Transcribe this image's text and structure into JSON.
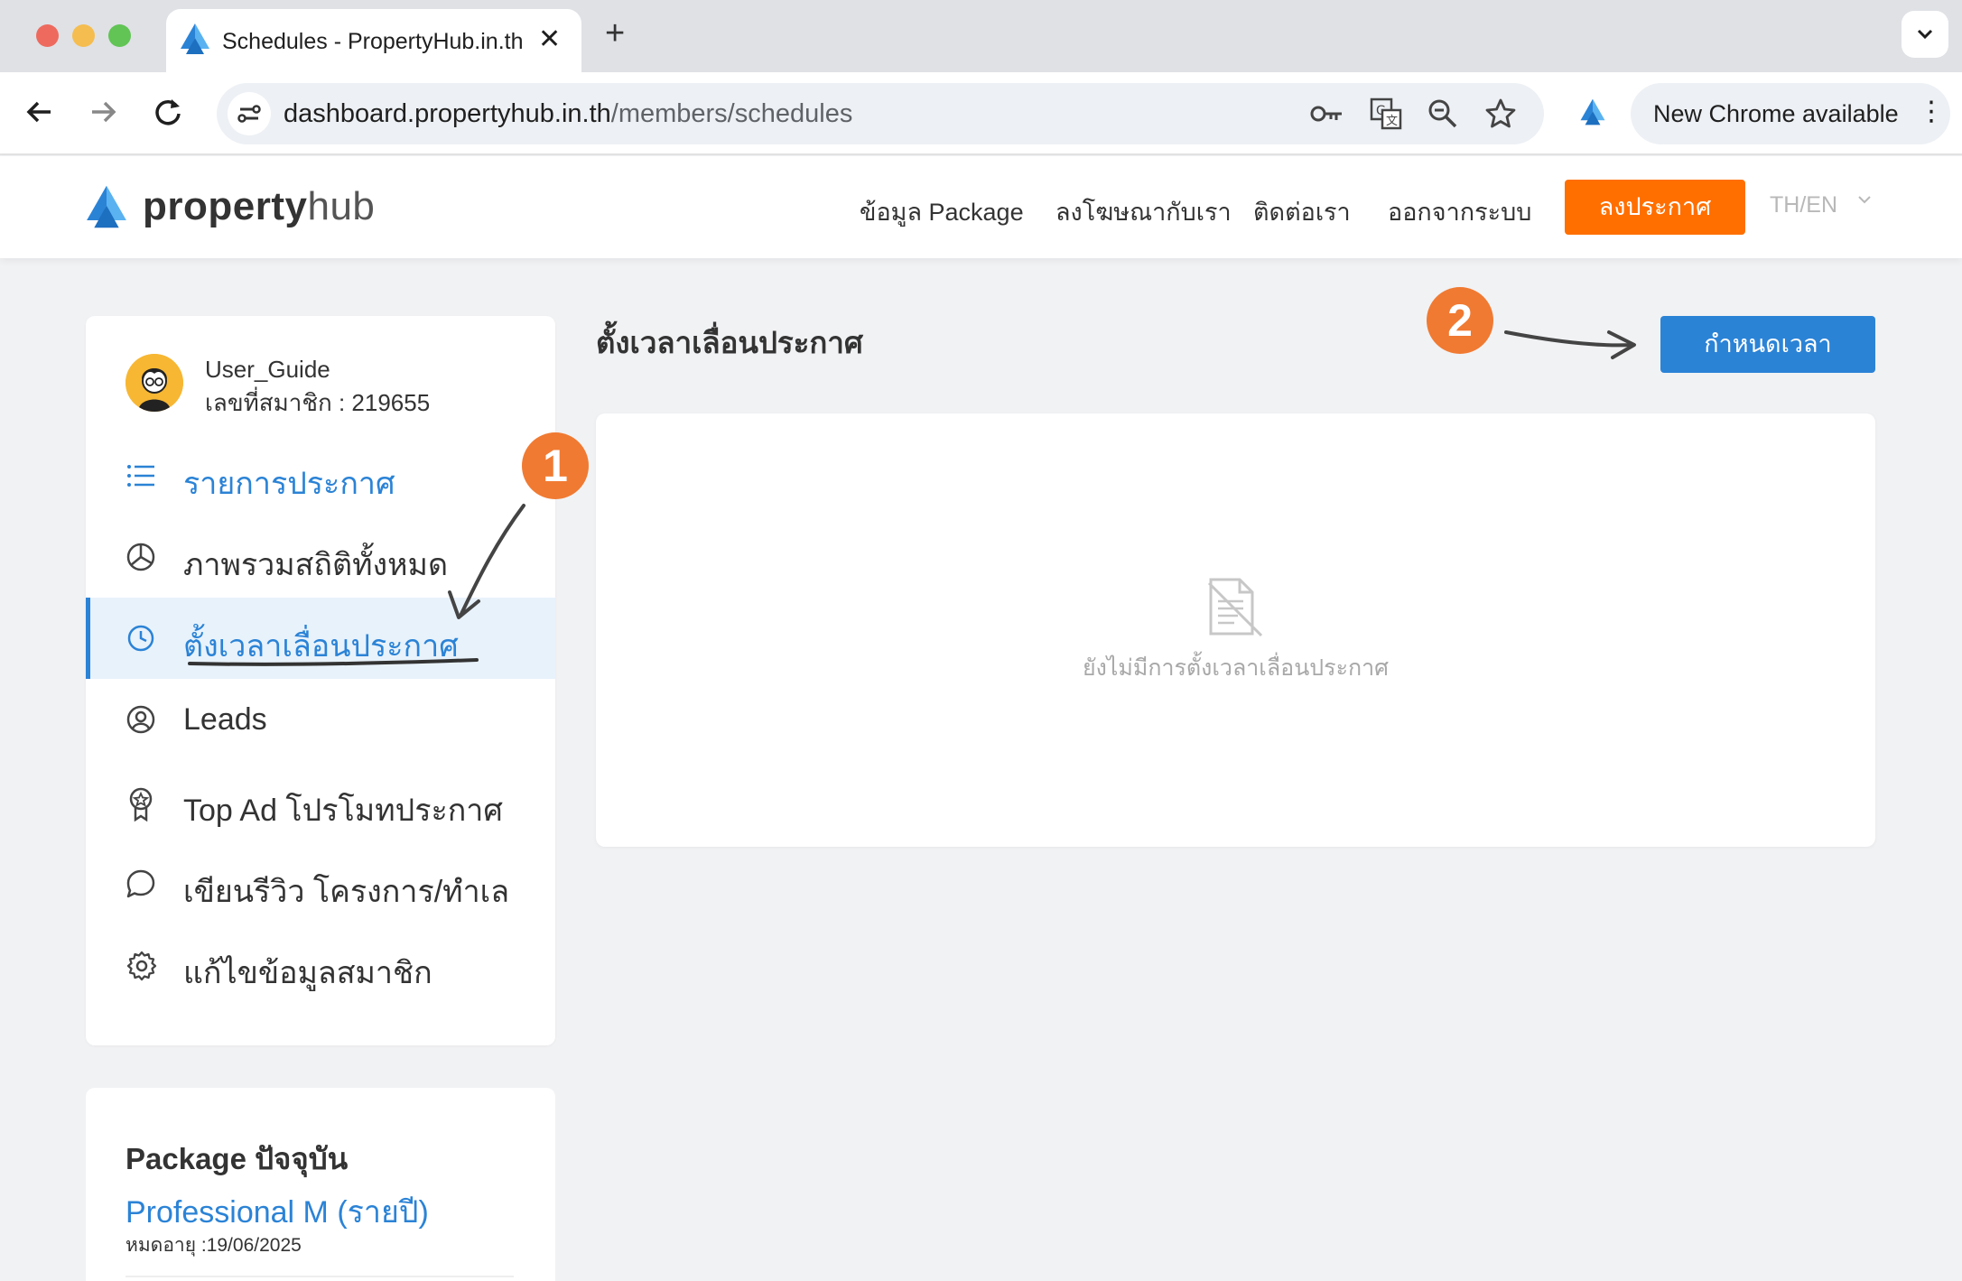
{
  "browser": {
    "tab_title": "Schedules - PropertyHub.in.th",
    "new_tab_symbol": "+",
    "close_symbol": "✕",
    "url_domain": "dashboard.propertyhub.in.th",
    "url_path": "/members/schedules",
    "update_label": "New Chrome available",
    "menu_symbol": "⋮"
  },
  "header": {
    "logo_bold": "property",
    "logo_light": "hub",
    "nav": [
      "ข้อมูล Package",
      "ลงโฆษณากับเรา",
      "ติดต่อเรา",
      "ออกจากระบบ"
    ],
    "post_button": "ลงประกาศ",
    "language": "TH/EN"
  },
  "sidebar": {
    "user_name": "User_Guide",
    "member_id": "เลขที่สมาชิก : 219655",
    "items": [
      {
        "label": "รายการประกาศ",
        "icon": "list-icon"
      },
      {
        "label": "ภาพรวมสถิติทั้งหมด",
        "icon": "pie-chart-icon"
      },
      {
        "label": "ตั้งเวลาเลื่อนประกาศ",
        "icon": "clock-icon"
      },
      {
        "label": "Leads",
        "icon": "user-circle-icon"
      },
      {
        "label": "Top Ad โปรโมทประกาศ",
        "icon": "award-icon"
      },
      {
        "label": "เขียนรีวิว โครงการ/ทำเล",
        "icon": "chat-bubble-icon"
      },
      {
        "label": "แก้ไขข้อมูลสมาชิก",
        "icon": "gear-icon"
      }
    ]
  },
  "package": {
    "title": "Package ปัจจุบัน",
    "name": "Professional M (รายปี)",
    "expire": "หมดอายุ :19/06/2025"
  },
  "main": {
    "title": "ตั้งเวลาเลื่อนประกาศ",
    "schedule_button": "กำหนดเวลา",
    "empty_message": "ยังไม่มีการตั้งเวลาเลื่อนประกาศ"
  },
  "annotations": {
    "step1": "1",
    "step2": "2"
  },
  "colors": {
    "brand_blue": "#2b83d6",
    "brand_orange": "#ff6f00",
    "annotation_orange": "#f07a32",
    "active_bg": "#e8f2fb"
  }
}
